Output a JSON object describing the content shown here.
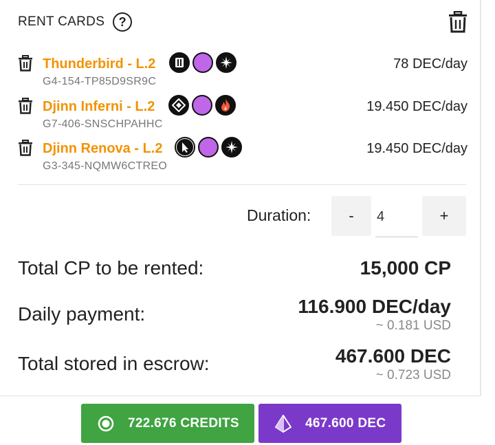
{
  "header": {
    "title": "RENT CARDS",
    "help_icon": "question-circle-icon",
    "clear_icon": "trash-icon"
  },
  "cards": [
    {
      "name": "Thunderbird - L.2",
      "id": "G4-154-TP85D9SR9C",
      "price": "78 DEC/day",
      "badges": [
        "ability-icon",
        "magic-icon",
        "star-icon"
      ]
    },
    {
      "name": "Djinn Inferni - L.2",
      "id": "G7-406-SNSCHPAHHC",
      "price": "19.450 DEC/day",
      "badges": [
        "diamond-ability-icon",
        "magic-icon",
        "fire-icon"
      ]
    },
    {
      "name": "Djinn Renova - L.2",
      "id": "G3-345-NQMW6CTREO",
      "price": "19.450 DEC/day",
      "badges": [
        "cursor-ability-icon",
        "magic-icon",
        "star-icon"
      ]
    }
  ],
  "duration": {
    "label": "Duration:",
    "value": "4",
    "minus": "-",
    "plus": "+"
  },
  "summary": {
    "total_cp_label": "Total CP to be rented:",
    "total_cp_value": "15,000 CP",
    "daily_label": "Daily payment:",
    "daily_value": "116.900 DEC/day",
    "daily_usd": "~ 0.181 USD",
    "escrow_label": "Total stored in escrow:",
    "escrow_value": "467.600 DEC",
    "escrow_usd": "~ 0.723 USD"
  },
  "footer": {
    "credits_label": "722.676 CREDITS",
    "dec_label": "467.600 DEC",
    "colors": {
      "credits": "#3fa441",
      "dec": "#7b39c9",
      "card_name": "#f39200"
    }
  }
}
